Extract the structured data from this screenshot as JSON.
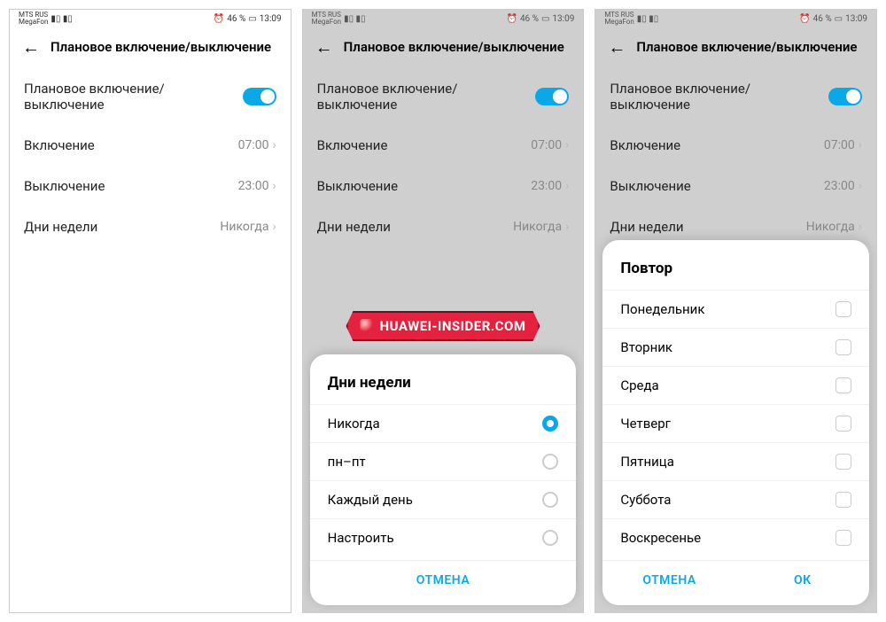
{
  "status": {
    "carrier1": "MTS RUS",
    "carrier2": "MegaFon",
    "signal_icons": "📶 📶",
    "battery": "46 %",
    "time": "13:09",
    "alarm": "⏰"
  },
  "screen": {
    "title": "Плановое включение/выключение",
    "toggle_label": "Плановое включение/\nвыключение",
    "rows": {
      "on_label": "Включение",
      "on_value": "07:00",
      "off_label": "Выключение",
      "off_value": "23:00",
      "days_label": "Дни недели",
      "days_value": "Никогда"
    }
  },
  "sheet_days": {
    "title": "Дни недели",
    "options": [
      {
        "label": "Никогда",
        "selected": true
      },
      {
        "label": "пн–пт",
        "selected": false
      },
      {
        "label": "Каждый день",
        "selected": false
      },
      {
        "label": "Настроить",
        "selected": false
      }
    ],
    "cancel": "ОТМЕНА"
  },
  "sheet_repeat": {
    "title": "Повтор",
    "options": [
      {
        "label": "Понедельник"
      },
      {
        "label": "Вторник"
      },
      {
        "label": "Среда"
      },
      {
        "label": "Четверг"
      },
      {
        "label": "Пятница"
      },
      {
        "label": "Суббота"
      },
      {
        "label": "Воскресенье"
      }
    ],
    "cancel": "ОТМЕНА",
    "ok": "ОК"
  },
  "watermark": "HUAWEI-INSIDER.COM"
}
